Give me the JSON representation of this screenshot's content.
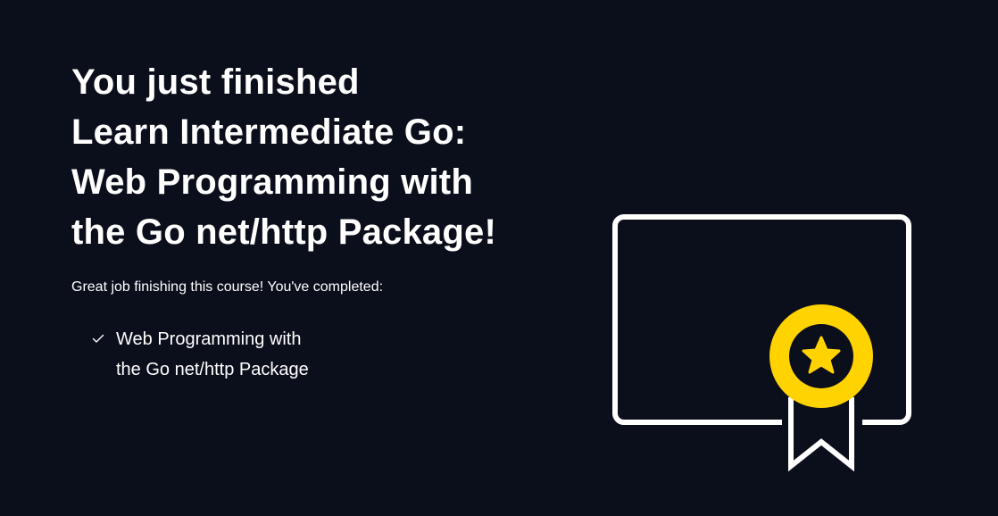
{
  "heading": {
    "line1": "You just finished",
    "line2": "Learn Intermediate Go:",
    "line3": "Web Programming with",
    "line4": "the Go net/http Package!"
  },
  "subtitle": "Great job finishing this course! You've completed:",
  "completed": [
    {
      "icon": "check-icon",
      "label": "Web Programming with the Go net/http Package"
    }
  ],
  "illustration": {
    "icon": "certificate-award-icon",
    "frame_color": "#ffffff",
    "badge_color": "#ffd300",
    "background_color": "#0b0e1b"
  }
}
